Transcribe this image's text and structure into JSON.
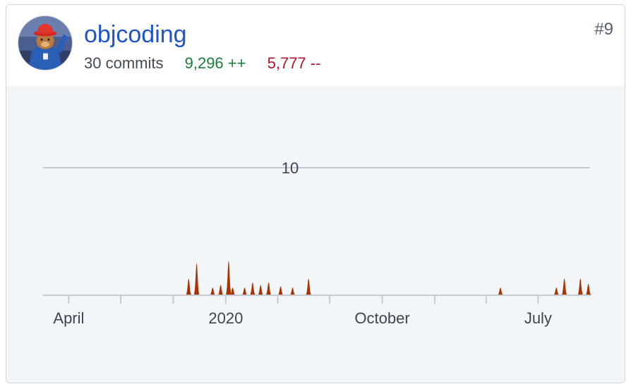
{
  "contributor": {
    "username": "objcoding",
    "rank": "#9",
    "commits": "30 commits",
    "additions": "9,296 ++",
    "deletions": "5,777 --",
    "avatar_icon": "bear-avatar-icon"
  },
  "colors": {
    "link": "#1f55c9",
    "additions": "#1a7f37",
    "deletions": "#b3132e",
    "area_fill": "#a83200",
    "grid": "#c5cbd3",
    "chart_bg": "#f3f6f9"
  },
  "chart_data": {
    "type": "area",
    "title": "",
    "ylabel": "",
    "xlabel": "",
    "ylim": [
      0,
      15
    ],
    "y_ticks": [
      10
    ],
    "x_tick_labels": [
      "April",
      "2020",
      "October",
      "July"
    ],
    "x_domain": [
      "2019-02-15",
      "2021-09-30"
    ],
    "x_label_dates": [
      "2019-04-01",
      "2020-01-01",
      "2020-10-01",
      "2021-07-01"
    ],
    "series": [
      {
        "points": [
          {
            "date": "2019-10-28",
            "value": 1.3
          },
          {
            "date": "2019-11-11",
            "value": 2.5
          },
          {
            "date": "2019-12-09",
            "value": 0.6
          },
          {
            "date": "2019-12-23",
            "value": 0.8
          },
          {
            "date": "2020-01-06",
            "value": 2.7
          },
          {
            "date": "2020-01-13",
            "value": 0.6
          },
          {
            "date": "2020-02-03",
            "value": 0.6
          },
          {
            "date": "2020-02-17",
            "value": 1.0
          },
          {
            "date": "2020-03-02",
            "value": 0.8
          },
          {
            "date": "2020-03-16",
            "value": 1.0
          },
          {
            "date": "2020-04-06",
            "value": 0.7
          },
          {
            "date": "2020-04-27",
            "value": 0.6
          },
          {
            "date": "2020-05-25",
            "value": 1.3
          },
          {
            "date": "2021-04-26",
            "value": 0.6
          },
          {
            "date": "2021-08-02",
            "value": 0.6
          },
          {
            "date": "2021-08-16",
            "value": 1.3
          },
          {
            "date": "2021-09-13",
            "value": 1.3
          },
          {
            "date": "2021-09-27",
            "value": 0.9
          }
        ]
      }
    ]
  }
}
